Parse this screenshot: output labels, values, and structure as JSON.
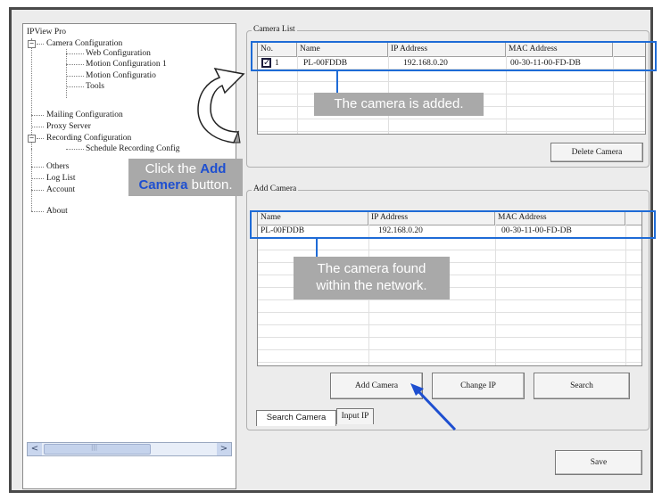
{
  "tree": {
    "root": "IPView Pro",
    "camera_config": "Camera Configuration",
    "web_config": "Web Configuration",
    "motion_config_1": "Motion Configuration 1",
    "motion_config_2": "Motion Configuratio",
    "tools": "Tools",
    "mailing_config": "Mailing Configuration",
    "proxy_server": "Proxy Server",
    "recording_config": "Recording Configuration",
    "schedule_recording": "Schedule Recording Config",
    "others": "Others",
    "log_list": "Log List",
    "account": "Account",
    "about": "About",
    "expander_minus": "−"
  },
  "scroll": {
    "left_arrow": "<",
    "right_arrow": ">",
    "thumb_grip": "|||"
  },
  "camera_list": {
    "title": "Camera List",
    "columns": [
      "No.",
      "Name",
      "IP Address",
      "MAC Address"
    ],
    "rows": [
      {
        "no": "1",
        "name": "PL-00FDDB",
        "ip": "192.168.0.20",
        "mac": "00-30-11-00-FD-DB",
        "checked": true
      }
    ],
    "check_mark": "✓",
    "delete_button": "Delete Camera"
  },
  "add_camera": {
    "title": "Add Camera",
    "columns": [
      "Name",
      "IP Address",
      "MAC Address"
    ],
    "rows": [
      {
        "name": "PL-00FDDB",
        "ip": "192.168.0.20",
        "mac": "00-30-11-00-FD-DB"
      }
    ],
    "add_button": "Add Camera",
    "change_ip_button": "Change IP",
    "search_button": "Search",
    "tabs": [
      "Search Camera",
      "Input IP"
    ]
  },
  "save_button": "Save",
  "callouts": {
    "added": "The camera is added.",
    "found_line1": "The camera found",
    "found_line2": "within the network.",
    "click_prefix": "Click the ",
    "click_bold1": "Add",
    "click_bold2": "Camera",
    "click_suffix": " button."
  },
  "colors": {
    "highlight": "#1e6bd6",
    "callout_bg": "#a9a9a9",
    "callout_text": "#ffffff"
  }
}
